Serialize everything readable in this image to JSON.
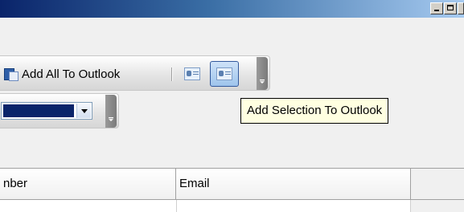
{
  "toolbar": {
    "add_all_label": "Add All To Outlook",
    "add_selection_tooltip": "Add Selection To Outlook"
  },
  "grid": {
    "columns": [
      "nber",
      "Email"
    ]
  },
  "colors": {
    "title_gradient_start": "#0a246a",
    "selection": "#0a246a",
    "tooltip_bg": "#ffffe1"
  },
  "icons": [
    "outlook-add-all-icon",
    "contact-card-icon",
    "add-selection-icon",
    "overflow-grip-icon",
    "dropdown-arrow-icon"
  ]
}
